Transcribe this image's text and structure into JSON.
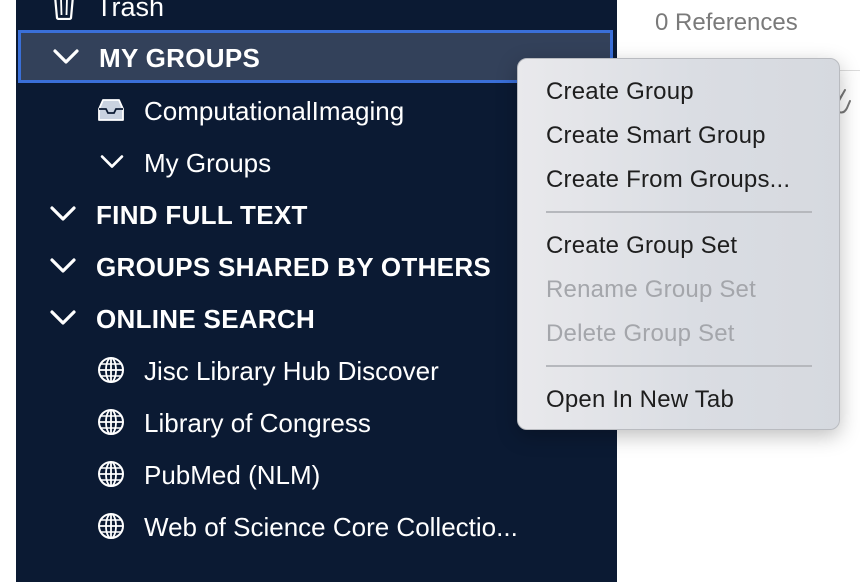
{
  "sidebar": {
    "trash": {
      "label": "Trash",
      "icon": "trash-icon"
    },
    "sections": [
      {
        "label": "MY GROUPS",
        "selected": true
      },
      {
        "label": "FIND FULL TEXT"
      },
      {
        "label": "GROUPS SHARED BY OTHERS"
      },
      {
        "label": "ONLINE SEARCH"
      }
    ],
    "my_groups_items": [
      {
        "label": "ComputationalImaging",
        "icon": "tray-icon"
      },
      {
        "label": "My Groups",
        "icon": "chevron-down-icon"
      }
    ],
    "online_search_items": [
      {
        "label": "Jisc Library Hub Discover",
        "icon": "globe-icon"
      },
      {
        "label": "Library of Congress",
        "icon": "globe-icon"
      },
      {
        "label": "PubMed (NLM)",
        "icon": "globe-icon"
      },
      {
        "label": "Web of Science Core Collectio...",
        "icon": "globe-icon"
      }
    ]
  },
  "right_pane": {
    "reference_count": "0 References"
  },
  "context_menu": {
    "items": [
      {
        "label": "Create Group",
        "enabled": true
      },
      {
        "label": "Create Smart Group",
        "enabled": true
      },
      {
        "label": "Create From Groups...",
        "enabled": true
      },
      {
        "label": "Create Group Set",
        "enabled": true
      },
      {
        "label": "Rename Group Set",
        "enabled": false
      },
      {
        "label": "Delete Group Set",
        "enabled": false
      },
      {
        "label": "Open In New Tab",
        "enabled": true
      }
    ]
  },
  "colors": {
    "sidebar_bg": "#0b1a33",
    "selection_bg": "#33415a",
    "selection_border": "#3a6fd8",
    "disabled_text": "#a4a6ab"
  }
}
